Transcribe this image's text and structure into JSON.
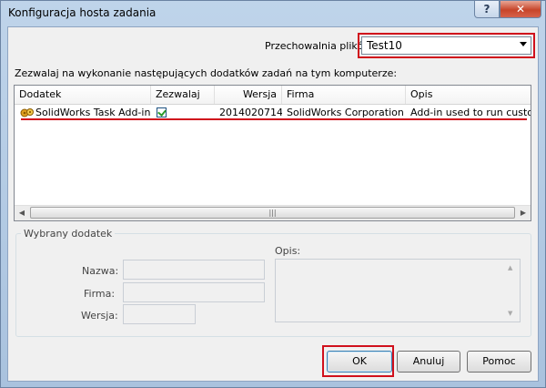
{
  "window": {
    "title": "Konfiguracja hosta zadania",
    "help_label": "?",
    "close_label": "✕"
  },
  "vault": {
    "label": "Przechowalnia plików:",
    "value": "Test10"
  },
  "addins": {
    "description": "Zezwalaj na wykonanie następujących dodatków zadań na tym komputerze:",
    "columns": [
      "Dodatek",
      "Zezwalaj",
      "Wersja",
      "Firma",
      "Opis"
    ],
    "rows": [
      {
        "name": "SolidWorks Task Add-in",
        "allowed": true,
        "version": "2014020714",
        "company": "SolidWorks Corporation",
        "description": "Add-in used to run custom ..."
      }
    ]
  },
  "selected": {
    "group_title": "Wybrany dodatek",
    "name_label": "Nazwa:",
    "company_label": "Firma:",
    "version_label": "Wersja:",
    "desc_label": "Opis:"
  },
  "buttons": {
    "ok": "OK",
    "cancel": "Anuluj",
    "help": "Pomoc"
  },
  "colors": {
    "highlight": "#d0101c",
    "accent": "#3c7fb1"
  }
}
